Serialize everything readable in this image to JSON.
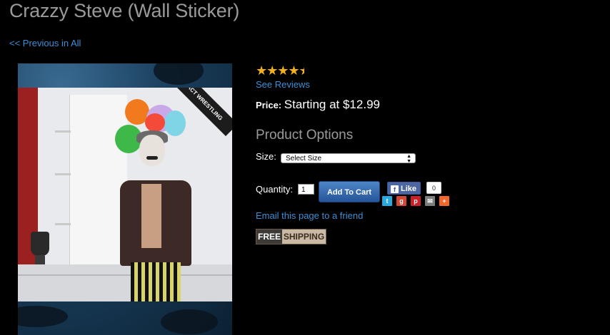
{
  "page": {
    "title": "Crazzy Steve (Wall Sticker)",
    "previous_link": "<< Previous in All"
  },
  "product_image": {
    "badge": "TNA IMPACT WRESTLING"
  },
  "rating": {
    "stars": "★★★★★",
    "value": 4.5,
    "see_reviews": "See Reviews"
  },
  "price": {
    "label": "Price:",
    "value": "Starting at $12.99"
  },
  "options": {
    "heading": "Product Options",
    "size_label": "Size:",
    "size_selected": "Select Size"
  },
  "purchase": {
    "quantity_label": "Quantity:",
    "quantity_value": "1",
    "add_to_cart": "Add To Cart"
  },
  "social": {
    "like_label": "Like",
    "like_count": "0",
    "share_icons": [
      "twitter-icon",
      "google-plus-icon",
      "pinterest-icon",
      "email-icon",
      "plus-icon"
    ]
  },
  "email_friend": "Email this page to a friend",
  "shipping_badge": {
    "free": "FREE",
    "shipping": "SHIPPING"
  },
  "colors": {
    "link": "#3d8fd6",
    "star": "#f3b01a",
    "button": "#2f64aa"
  }
}
